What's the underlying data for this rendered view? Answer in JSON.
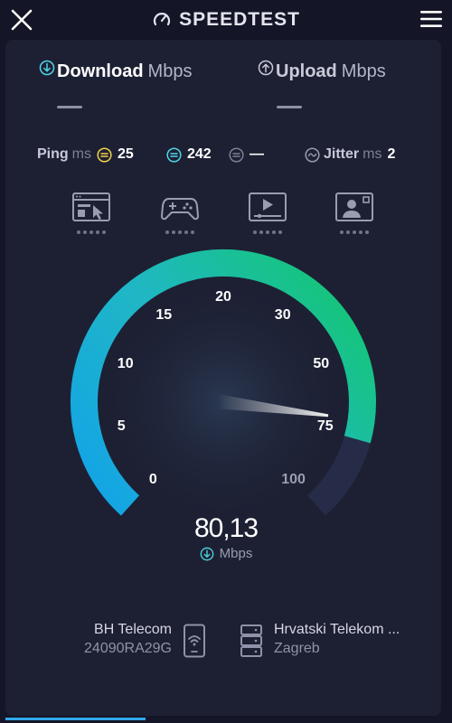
{
  "app": {
    "title": "SPEEDTEST"
  },
  "tabs": [
    {
      "label": "Download",
      "unit": "Mbps",
      "icon": "download-icon"
    },
    {
      "label": "Upload",
      "unit": "Mbps",
      "icon": "upload-icon"
    }
  ],
  "stats": {
    "ping": {
      "label": "Ping",
      "unit": "ms",
      "idle": "25",
      "download": "242",
      "upload": "—"
    },
    "jitter": {
      "label": "Jitter",
      "unit": "ms",
      "value": "2"
    }
  },
  "activities": [
    "web-browsing-icon",
    "gaming-icon",
    "video-streaming-icon",
    "video-call-icon"
  ],
  "gauge": {
    "ticks": [
      "0",
      "5",
      "10",
      "15",
      "20",
      "30",
      "50",
      "75",
      "100"
    ],
    "active_tick": "75"
  },
  "result": {
    "value": "80,13",
    "unit": "Mbps"
  },
  "provider": {
    "name": "BH Telecom",
    "ip": "24090RA29G"
  },
  "server": {
    "name": "Hrvatski Telekom ...",
    "city": "Zagreb"
  },
  "progress": {
    "fraction": 0.31
  },
  "colors": {
    "accent_start": "#12a3e8",
    "accent_end": "#16c47f",
    "background": "#141526",
    "card": "#1d2033"
  }
}
